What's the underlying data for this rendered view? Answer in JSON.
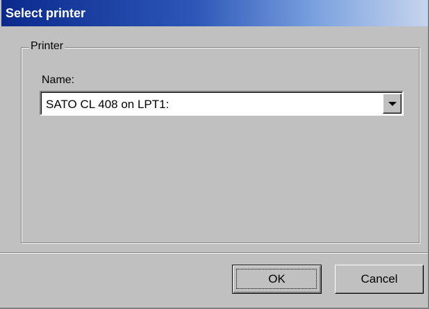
{
  "window": {
    "title": "Select printer"
  },
  "printer_group": {
    "legend": "Printer",
    "name_label": "Name:",
    "selected_printer": "SATO CL 408 on LPT1:"
  },
  "buttons": {
    "ok_label": "OK",
    "cancel_label": "Cancel"
  },
  "colors": {
    "title_bar_start": "#0b2a8c",
    "title_bar_end": "#c6d4ee",
    "dialog_face": "#c0c0c0"
  },
  "icons": {
    "dropdown": "chevron-down-icon"
  }
}
